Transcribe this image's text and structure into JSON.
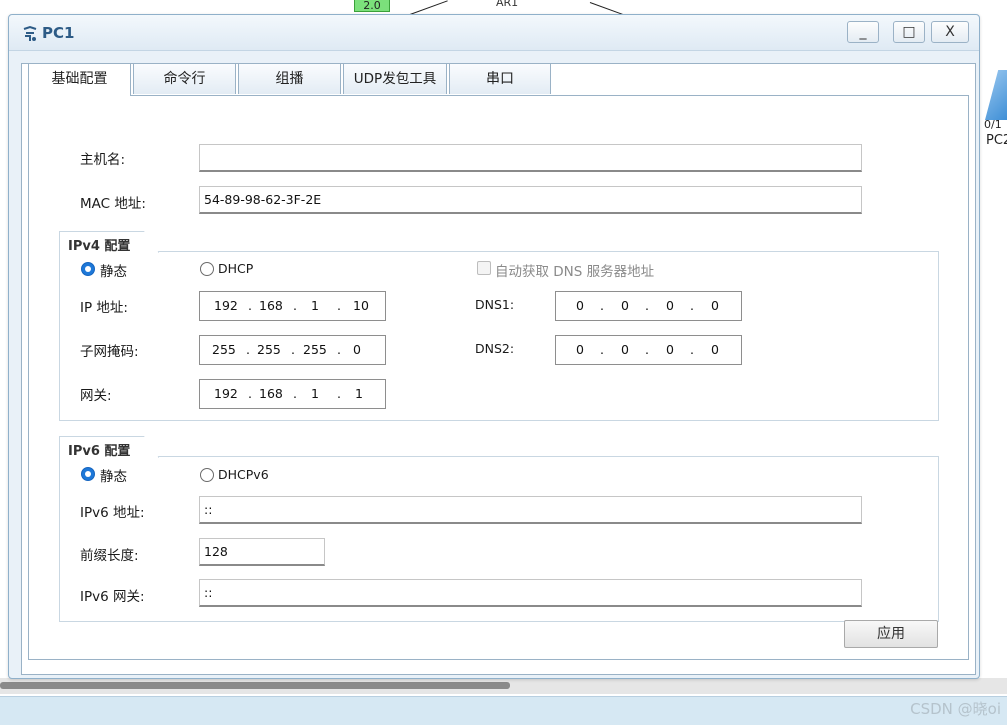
{
  "background": {
    "link_badge": "2.0",
    "top_mark": "AR1",
    "device_port": "0/1",
    "device_name": "PC2",
    "watermark": "CSDN @晓oi"
  },
  "window": {
    "title": "PC1",
    "min_label": "_",
    "max_label": "□",
    "close_label": "X"
  },
  "tabs": [
    {
      "label": "基础配置",
      "active": true
    },
    {
      "label": "命令行",
      "active": false
    },
    {
      "label": "组播",
      "active": false
    },
    {
      "label": "UDP发包工具",
      "active": false
    },
    {
      "label": "串口",
      "active": false
    }
  ],
  "basic": {
    "hostname_label": "主机名:",
    "hostname_value": "",
    "mac_label": "MAC 地址:",
    "mac_value": "54-89-98-62-3F-2E"
  },
  "ipv4": {
    "group_title": "IPv4 配置",
    "static_label": "静态",
    "dhcp_label": "DHCP",
    "auto_dns_label": "自动获取 DNS 服务器地址",
    "ip_label": "IP 地址:",
    "ip_octets": [
      "192",
      "168",
      "1",
      "10"
    ],
    "mask_label": "子网掩码:",
    "mask_octets": [
      "255",
      "255",
      "255",
      "0"
    ],
    "gateway_label": "网关:",
    "gateway_octets": [
      "192",
      "168",
      "1",
      "1"
    ],
    "dns1_label": "DNS1:",
    "dns1_octets": [
      "0",
      "0",
      "0",
      "0"
    ],
    "dns2_label": "DNS2:",
    "dns2_octets": [
      "0",
      "0",
      "0",
      "0"
    ],
    "dot": "."
  },
  "ipv6": {
    "group_title": "IPv6 配置",
    "static_label": "静态",
    "dhcp_label": "DHCPv6",
    "addr_label": "IPv6 地址:",
    "addr_value": "::",
    "prefix_label": "前缀长度:",
    "prefix_value": "128",
    "gateway_label": "IPv6 网关:",
    "gateway_value": "::"
  },
  "apply_label": "应用"
}
